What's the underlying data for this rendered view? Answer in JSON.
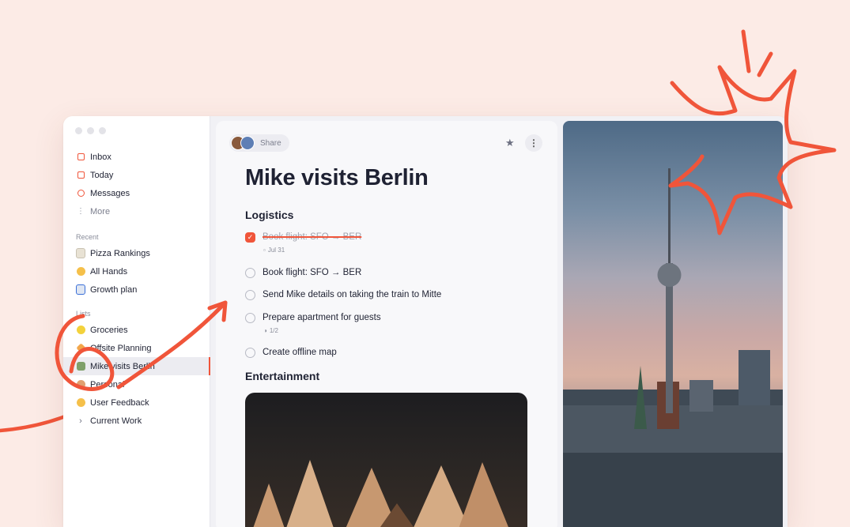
{
  "sidebar": {
    "nav": [
      {
        "label": "Inbox",
        "icon": "inbox-icon"
      },
      {
        "label": "Today",
        "icon": "calendar-icon"
      },
      {
        "label": "Messages",
        "icon": "messages-icon"
      },
      {
        "label": "More",
        "icon": "more-vertical-icon"
      }
    ],
    "recent_label": "Recent",
    "recent": [
      {
        "label": "Pizza Rankings",
        "icon": "notepad-emoji-icon"
      },
      {
        "label": "All Hands",
        "icon": "raised-hands-emoji-icon"
      },
      {
        "label": "Growth plan",
        "icon": "chart-emoji-icon"
      }
    ],
    "lists_label": "Lists",
    "lists": [
      {
        "label": "Groceries",
        "icon": "lemon-emoji-icon"
      },
      {
        "label": "Offsite Planning",
        "icon": "party-popper-emoji-icon"
      },
      {
        "label": "Mike visits Berlin",
        "icon": "berlin-emoji-icon"
      },
      {
        "label": "Personal",
        "icon": "personal-emoji-icon"
      },
      {
        "label": "User Feedback",
        "icon": "smiley-emoji-icon"
      },
      {
        "label": "Current Work",
        "icon": "chevron-right-icon"
      }
    ]
  },
  "doc": {
    "share_label": "Share",
    "title": "Mike visits Berlin",
    "section1": "Logistics",
    "tasks": [
      {
        "text": "Book flight: SFO → BER",
        "done": true,
        "meta": "Jul 31"
      },
      {
        "text": "Book flight: SFO → BER",
        "done": false
      },
      {
        "text": "Send Mike details on taking the train to Mitte",
        "done": false
      },
      {
        "text": "Prepare apartment for guests",
        "done": false,
        "meta": "1/2"
      },
      {
        "text": "Create offline map",
        "done": false
      }
    ],
    "section2": "Entertainment"
  },
  "colors": {
    "accent": "#f0553a",
    "background": "#fcebe6"
  }
}
